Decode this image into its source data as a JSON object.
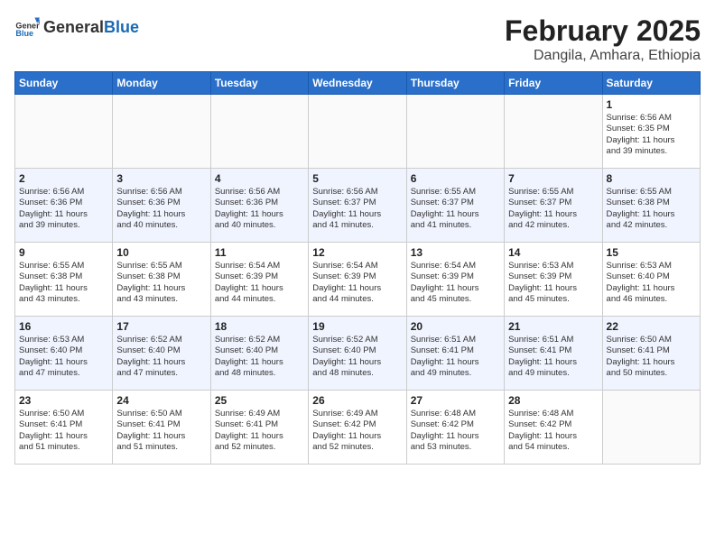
{
  "logo": {
    "text_general": "General",
    "text_blue": "Blue"
  },
  "header": {
    "month": "February 2025",
    "location": "Dangila, Amhara, Ethiopia"
  },
  "days_of_week": [
    "Sunday",
    "Monday",
    "Tuesday",
    "Wednesday",
    "Thursday",
    "Friday",
    "Saturday"
  ],
  "weeks": [
    [
      {
        "day": "",
        "info": ""
      },
      {
        "day": "",
        "info": ""
      },
      {
        "day": "",
        "info": ""
      },
      {
        "day": "",
        "info": ""
      },
      {
        "day": "",
        "info": ""
      },
      {
        "day": "",
        "info": ""
      },
      {
        "day": "1",
        "info": "Sunrise: 6:56 AM\nSunset: 6:35 PM\nDaylight: 11 hours\nand 39 minutes."
      }
    ],
    [
      {
        "day": "2",
        "info": "Sunrise: 6:56 AM\nSunset: 6:36 PM\nDaylight: 11 hours\nand 39 minutes."
      },
      {
        "day": "3",
        "info": "Sunrise: 6:56 AM\nSunset: 6:36 PM\nDaylight: 11 hours\nand 40 minutes."
      },
      {
        "day": "4",
        "info": "Sunrise: 6:56 AM\nSunset: 6:36 PM\nDaylight: 11 hours\nand 40 minutes."
      },
      {
        "day": "5",
        "info": "Sunrise: 6:56 AM\nSunset: 6:37 PM\nDaylight: 11 hours\nand 41 minutes."
      },
      {
        "day": "6",
        "info": "Sunrise: 6:55 AM\nSunset: 6:37 PM\nDaylight: 11 hours\nand 41 minutes."
      },
      {
        "day": "7",
        "info": "Sunrise: 6:55 AM\nSunset: 6:37 PM\nDaylight: 11 hours\nand 42 minutes."
      },
      {
        "day": "8",
        "info": "Sunrise: 6:55 AM\nSunset: 6:38 PM\nDaylight: 11 hours\nand 42 minutes."
      }
    ],
    [
      {
        "day": "9",
        "info": "Sunrise: 6:55 AM\nSunset: 6:38 PM\nDaylight: 11 hours\nand 43 minutes."
      },
      {
        "day": "10",
        "info": "Sunrise: 6:55 AM\nSunset: 6:38 PM\nDaylight: 11 hours\nand 43 minutes."
      },
      {
        "day": "11",
        "info": "Sunrise: 6:54 AM\nSunset: 6:39 PM\nDaylight: 11 hours\nand 44 minutes."
      },
      {
        "day": "12",
        "info": "Sunrise: 6:54 AM\nSunset: 6:39 PM\nDaylight: 11 hours\nand 44 minutes."
      },
      {
        "day": "13",
        "info": "Sunrise: 6:54 AM\nSunset: 6:39 PM\nDaylight: 11 hours\nand 45 minutes."
      },
      {
        "day": "14",
        "info": "Sunrise: 6:53 AM\nSunset: 6:39 PM\nDaylight: 11 hours\nand 45 minutes."
      },
      {
        "day": "15",
        "info": "Sunrise: 6:53 AM\nSunset: 6:40 PM\nDaylight: 11 hours\nand 46 minutes."
      }
    ],
    [
      {
        "day": "16",
        "info": "Sunrise: 6:53 AM\nSunset: 6:40 PM\nDaylight: 11 hours\nand 47 minutes."
      },
      {
        "day": "17",
        "info": "Sunrise: 6:52 AM\nSunset: 6:40 PM\nDaylight: 11 hours\nand 47 minutes."
      },
      {
        "day": "18",
        "info": "Sunrise: 6:52 AM\nSunset: 6:40 PM\nDaylight: 11 hours\nand 48 minutes."
      },
      {
        "day": "19",
        "info": "Sunrise: 6:52 AM\nSunset: 6:40 PM\nDaylight: 11 hours\nand 48 minutes."
      },
      {
        "day": "20",
        "info": "Sunrise: 6:51 AM\nSunset: 6:41 PM\nDaylight: 11 hours\nand 49 minutes."
      },
      {
        "day": "21",
        "info": "Sunrise: 6:51 AM\nSunset: 6:41 PM\nDaylight: 11 hours\nand 49 minutes."
      },
      {
        "day": "22",
        "info": "Sunrise: 6:50 AM\nSunset: 6:41 PM\nDaylight: 11 hours\nand 50 minutes."
      }
    ],
    [
      {
        "day": "23",
        "info": "Sunrise: 6:50 AM\nSunset: 6:41 PM\nDaylight: 11 hours\nand 51 minutes."
      },
      {
        "day": "24",
        "info": "Sunrise: 6:50 AM\nSunset: 6:41 PM\nDaylight: 11 hours\nand 51 minutes."
      },
      {
        "day": "25",
        "info": "Sunrise: 6:49 AM\nSunset: 6:41 PM\nDaylight: 11 hours\nand 52 minutes."
      },
      {
        "day": "26",
        "info": "Sunrise: 6:49 AM\nSunset: 6:42 PM\nDaylight: 11 hours\nand 52 minutes."
      },
      {
        "day": "27",
        "info": "Sunrise: 6:48 AM\nSunset: 6:42 PM\nDaylight: 11 hours\nand 53 minutes."
      },
      {
        "day": "28",
        "info": "Sunrise: 6:48 AM\nSunset: 6:42 PM\nDaylight: 11 hours\nand 54 minutes."
      },
      {
        "day": "",
        "info": ""
      }
    ]
  ]
}
